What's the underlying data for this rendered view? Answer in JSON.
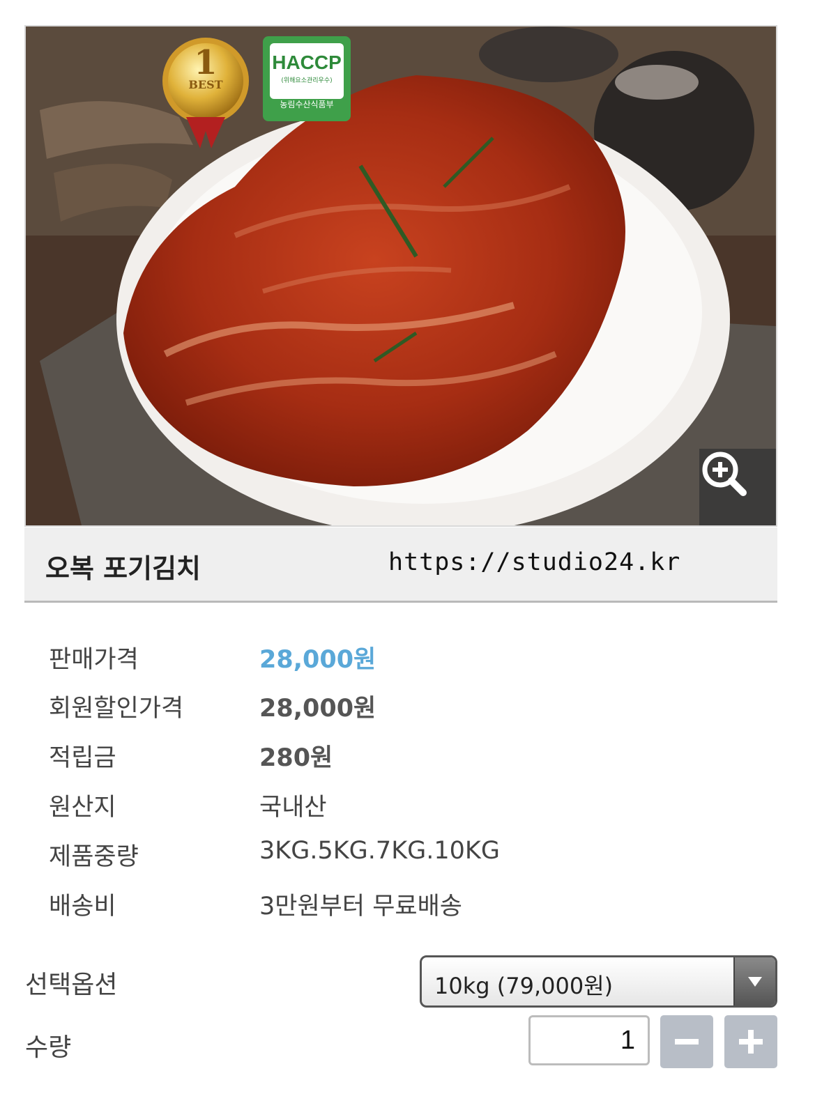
{
  "product": {
    "name": "오복 포기김치",
    "url": "https://studio24.kr",
    "badges": {
      "best_number": "1",
      "best_text": "BEST",
      "haccp_title": "HACCP",
      "haccp_sub": "(위해요소관리우수)",
      "haccp_org": "농림수산식품부"
    }
  },
  "info": [
    {
      "label": "판매가격",
      "value": "28,000원"
    },
    {
      "label": "회원할인가격",
      "value": "28,000원"
    },
    {
      "label": "적립금",
      "value": "280원"
    },
    {
      "label": "원산지",
      "value": "국내산"
    },
    {
      "label": "제품중량",
      "value": "3KG.5KG.7KG.10KG"
    },
    {
      "label": "배송비",
      "value": "3만원부터 무료배송"
    }
  ],
  "options": {
    "label": "선택옵션",
    "selected": "10kg (79,000원)"
  },
  "quantity": {
    "label": "수량",
    "value": "1"
  },
  "icons": {
    "zoom": "zoom-in-icon",
    "dropdown": "dropdown-arrow-icon",
    "minus": "minus-icon",
    "plus": "plus-icon"
  },
  "colors": {
    "price_accent": "#5aa8d8",
    "title_bar_bg": "#efefef",
    "qty_button": "#b8bec7"
  }
}
